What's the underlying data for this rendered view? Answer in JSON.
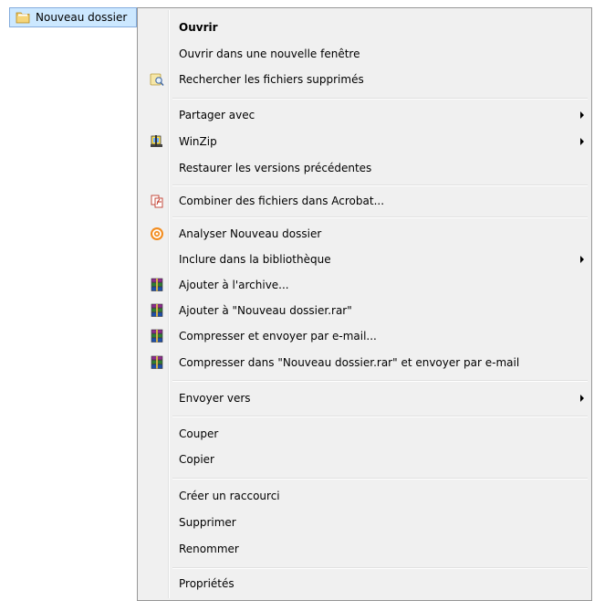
{
  "desktop": {
    "folder_label": "Nouveau dossier"
  },
  "menu": {
    "items": [
      {
        "label": "Ouvrir",
        "bold": true
      },
      {
        "label": "Ouvrir dans une nouvelle fenêtre"
      },
      {
        "label": "Rechercher les fichiers supprimés",
        "icon": "search-deleted-files-icon"
      },
      {
        "label": "Partager avec",
        "submenu": true
      },
      {
        "label": "WinZip",
        "icon": "winzip-icon",
        "submenu": true
      },
      {
        "label": "Restaurer les versions précédentes"
      },
      {
        "label": "Combiner des fichiers dans Acrobat...",
        "icon": "acrobat-icon"
      },
      {
        "label": "Analyser Nouveau dossier",
        "icon": "avast-icon"
      },
      {
        "label": "Inclure dans la bibliothèque",
        "submenu": true
      },
      {
        "label": "Ajouter à l'archive...",
        "icon": "winrar-icon"
      },
      {
        "label": "Ajouter à \"Nouveau dossier.rar\"",
        "icon": "winrar-icon"
      },
      {
        "label": "Compresser et envoyer par e-mail...",
        "icon": "winrar-icon"
      },
      {
        "label": "Compresser dans \"Nouveau dossier.rar\" et envoyer par e-mail",
        "icon": "winrar-icon"
      },
      {
        "label": "Envoyer vers",
        "submenu": true
      },
      {
        "label": "Couper"
      },
      {
        "label": "Copier"
      },
      {
        "label": "Créer un raccourci"
      },
      {
        "label": "Supprimer"
      },
      {
        "label": "Renommer"
      },
      {
        "label": "Propriétés"
      }
    ]
  },
  "colors": {
    "selection": "#cce8ff",
    "menu_bg": "#f0f0f0",
    "menu_border": "#979797"
  }
}
